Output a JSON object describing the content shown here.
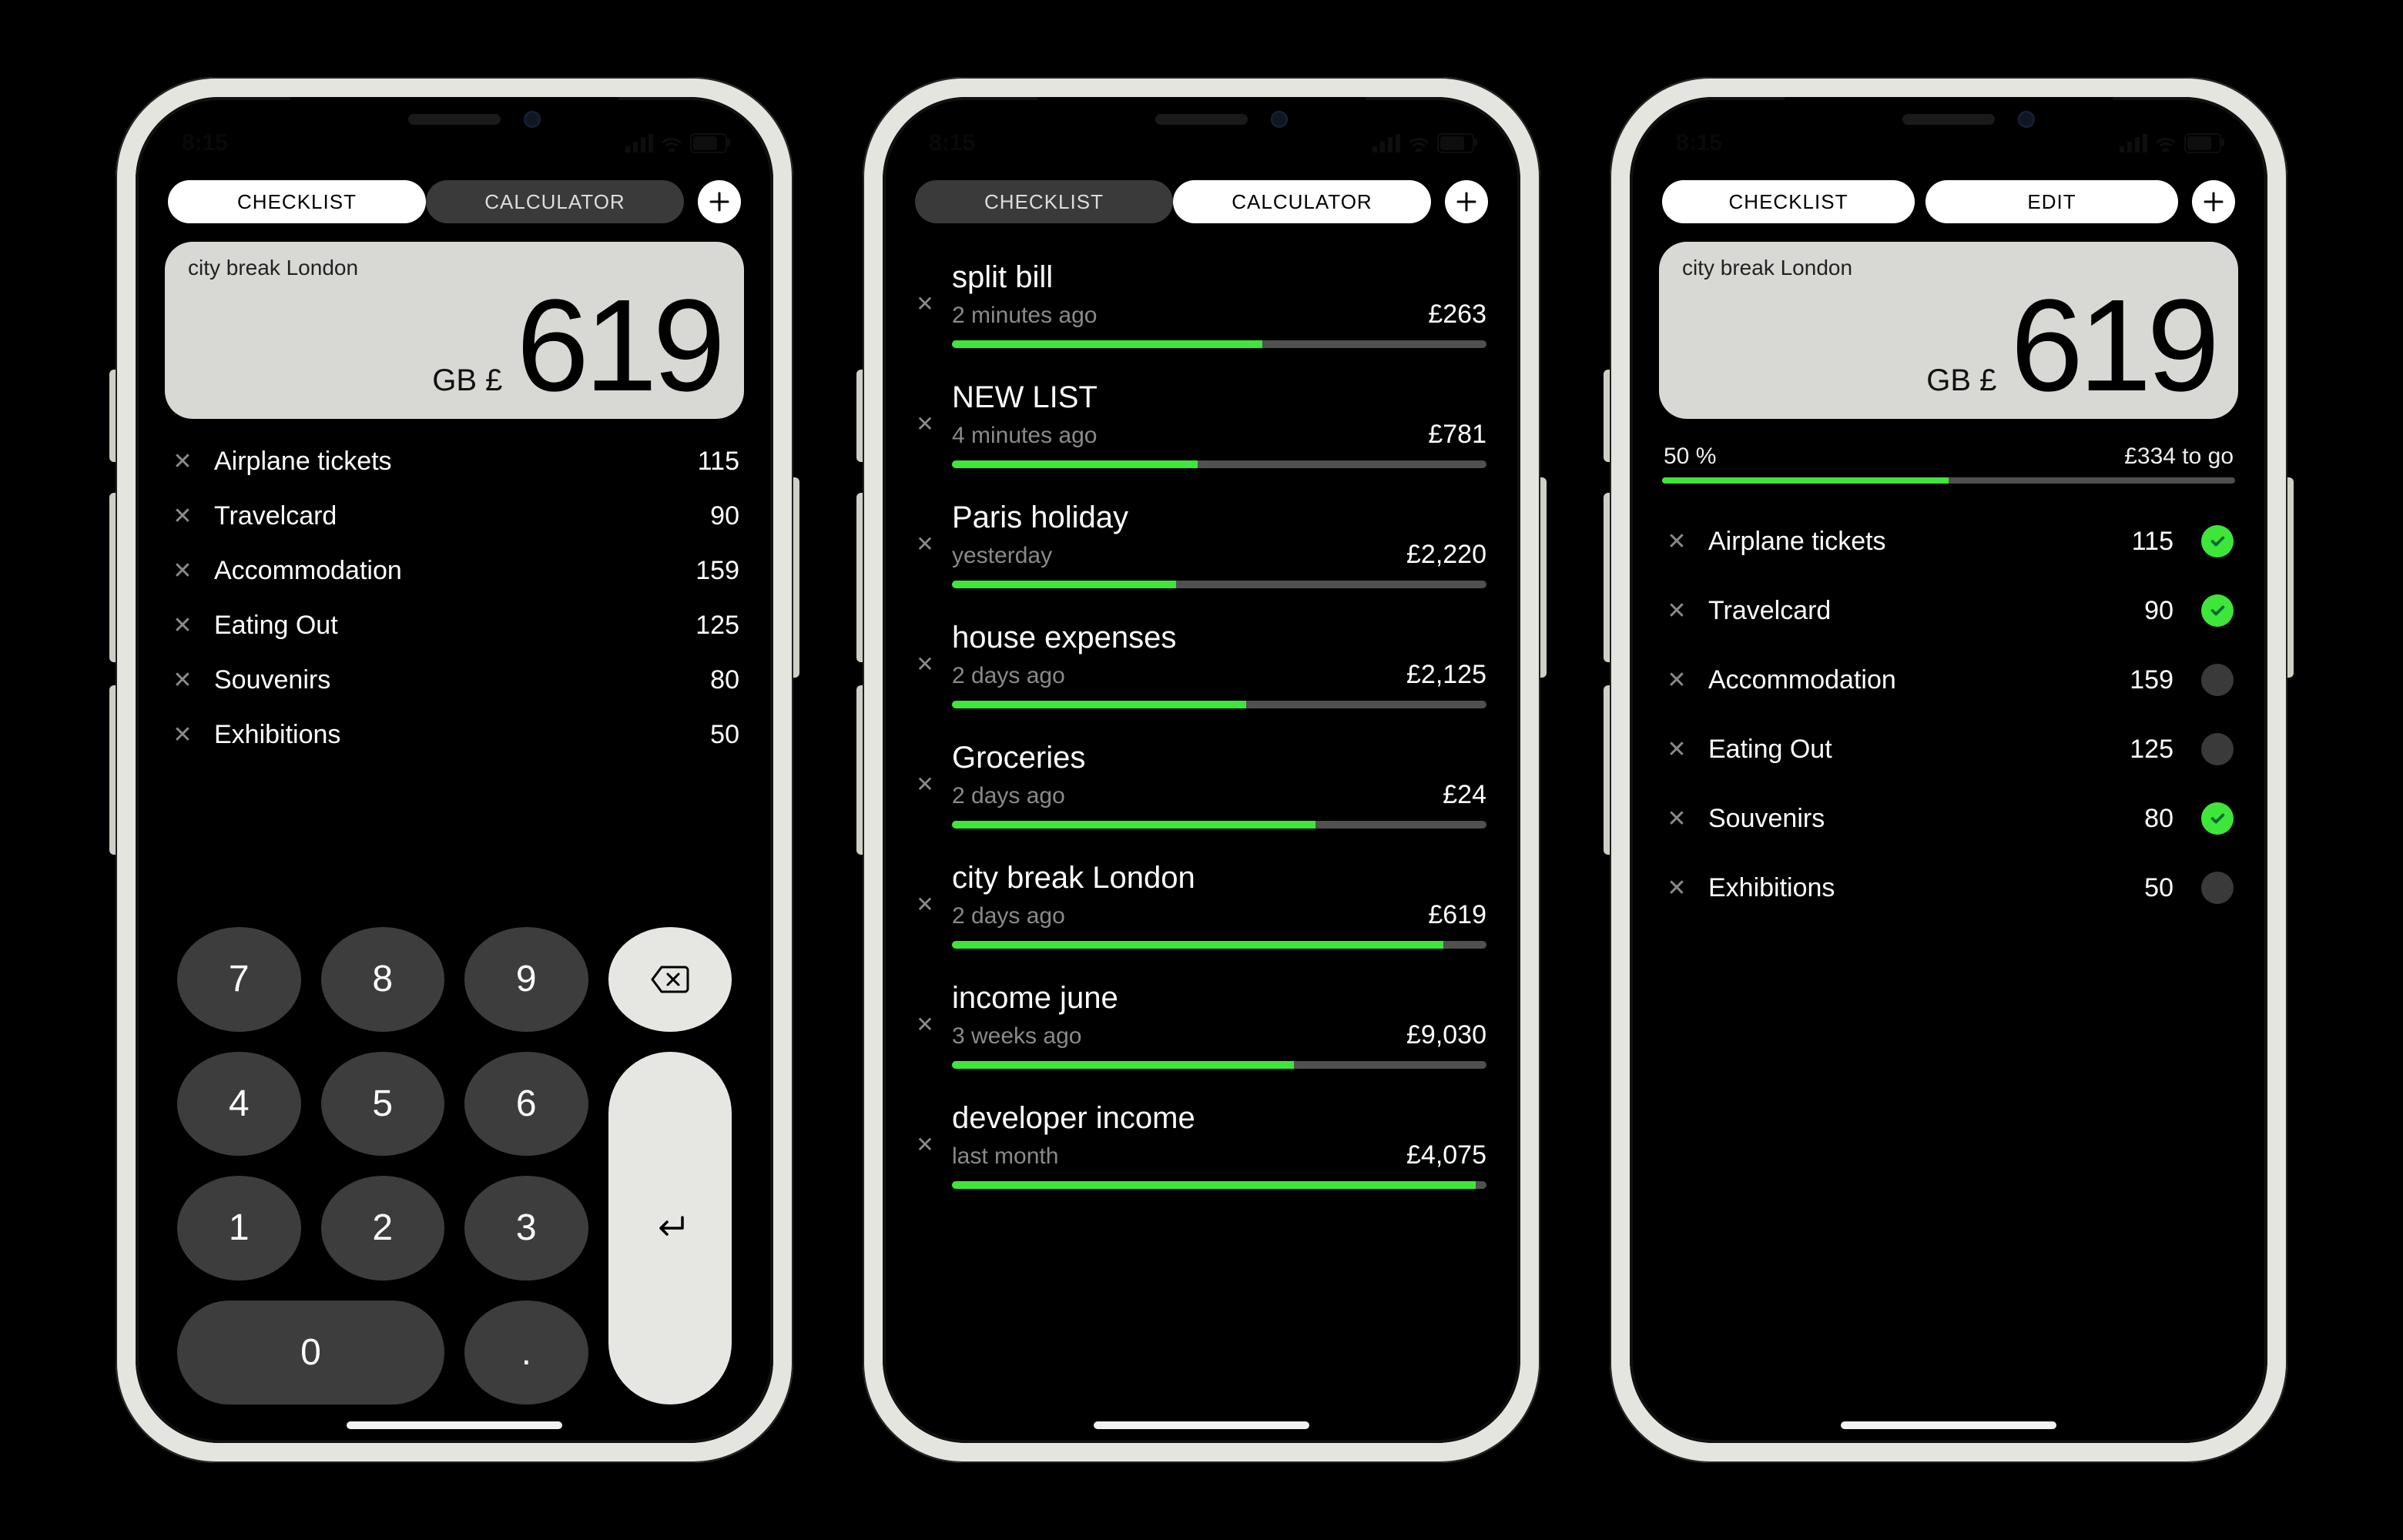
{
  "status": {
    "time": "8:15"
  },
  "tabs": {
    "checklist": "CHECKLIST",
    "calculator": "CALCULATOR",
    "edit": "EDIT"
  },
  "phone1": {
    "total": {
      "name": "city break London",
      "currency": "GB £",
      "amount": "619"
    },
    "items": [
      {
        "label": "Airplane tickets",
        "value": "115"
      },
      {
        "label": "Travelcard",
        "value": "90"
      },
      {
        "label": "Accommodation",
        "value": "159"
      },
      {
        "label": "Eating Out",
        "value": "125"
      },
      {
        "label": "Souvenirs",
        "value": "80"
      },
      {
        "label": "Exhibitions",
        "value": "50"
      }
    ],
    "keys": {
      "k7": "7",
      "k8": "8",
      "k9": "9",
      "k4": "4",
      "k5": "5",
      "k6": "6",
      "k1": "1",
      "k2": "2",
      "k3": "3",
      "k0": "0",
      "kdot": "."
    }
  },
  "phone2": {
    "lists": [
      {
        "name": "split bill",
        "time": "2 minutes ago",
        "amount": "£263",
        "progress": 58
      },
      {
        "name": "NEW LIST",
        "time": "4 minutes ago",
        "amount": "£781",
        "progress": 46
      },
      {
        "name": "Paris holiday",
        "time": "yesterday",
        "amount": "£2,220",
        "progress": 42
      },
      {
        "name": "house expenses",
        "time": "2 days ago",
        "amount": "£2,125",
        "progress": 55
      },
      {
        "name": "Groceries",
        "time": "2 days ago",
        "amount": "£24",
        "progress": 68
      },
      {
        "name": "city break London",
        "time": "2 days ago",
        "amount": "£619",
        "progress": 92
      },
      {
        "name": "income june",
        "time": "3 weeks ago",
        "amount": "£9,030",
        "progress": 64
      },
      {
        "name": "developer income",
        "time": "last month",
        "amount": "£4,075",
        "progress": 98
      }
    ]
  },
  "phone3": {
    "total": {
      "name": "city break London",
      "currency": "GB £",
      "amount": "619"
    },
    "progress": {
      "percent": "50 %",
      "togo": "£334 to go",
      "value": 50
    },
    "items": [
      {
        "label": "Airplane tickets",
        "value": "115",
        "checked": true
      },
      {
        "label": "Travelcard",
        "value": "90",
        "checked": true
      },
      {
        "label": "Accommodation",
        "value": "159",
        "checked": false
      },
      {
        "label": "Eating Out",
        "value": "125",
        "checked": false
      },
      {
        "label": "Souvenirs",
        "value": "80",
        "checked": true
      },
      {
        "label": "Exhibitions",
        "value": "50",
        "checked": false
      }
    ]
  }
}
